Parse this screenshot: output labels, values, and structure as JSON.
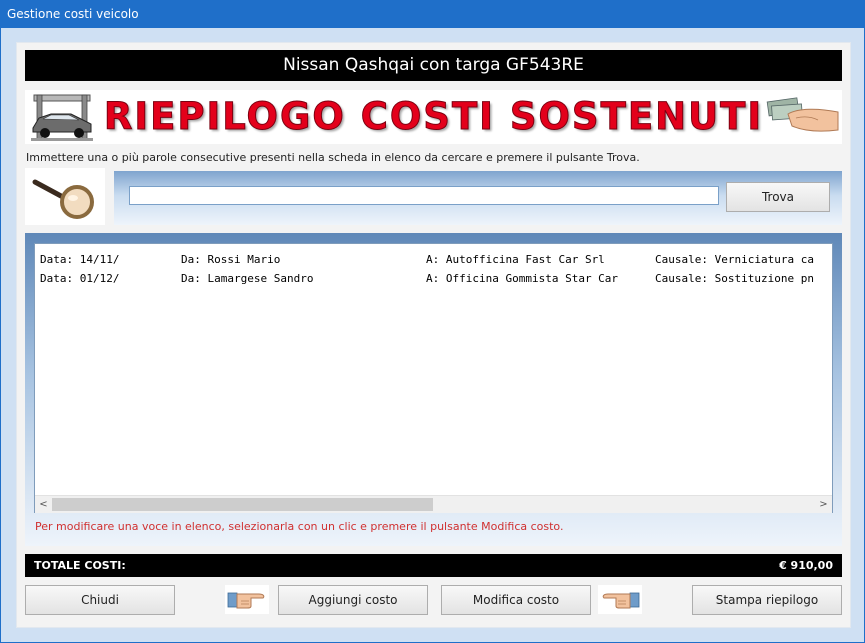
{
  "window": {
    "title": "Gestione costi veicolo"
  },
  "vehicle": {
    "title": "Nissan Qashqai con targa GF543RE"
  },
  "banner": {
    "title": "RIEPILOGO COSTI SOSTENUTI"
  },
  "search": {
    "instructions": "Immettere una o più parole consecutive presenti nella scheda in elenco da cercare e premere il pulsante Trova.",
    "value": "",
    "button": "Trova"
  },
  "list": {
    "rows": [
      {
        "data": "Data: 14/11/",
        "da": "Da: Rossi Mario",
        "a": "A: Autofficina Fast Car Srl",
        "causale": "Causale: Verniciatura ca"
      },
      {
        "data": "Data: 01/12/",
        "da": "Da: Lamargese Sandro",
        "a": "A: Officina Gommista Star Car",
        "causale": "Causale: Sostituzione pn"
      }
    ],
    "note": "Per modificare una voce in elenco, selezionarla con un clic e premere il pulsante Modifica costo."
  },
  "total": {
    "label": "TOTALE COSTI:",
    "value": "€ 910,00"
  },
  "buttons": {
    "close": "Chiudi",
    "add": "Aggiungi costo",
    "edit": "Modifica costo",
    "print": "Stampa riepilogo"
  },
  "icons": {
    "car_lift": "car-lift-icon",
    "money_hand": "money-hand-icon",
    "magnifier": "magnifier-icon",
    "pointing_hand": "pointing-hand-icon"
  },
  "colors": {
    "title_bar": "#1f6fc9",
    "banner_text": "#e3001b",
    "note_text": "#d03030"
  }
}
